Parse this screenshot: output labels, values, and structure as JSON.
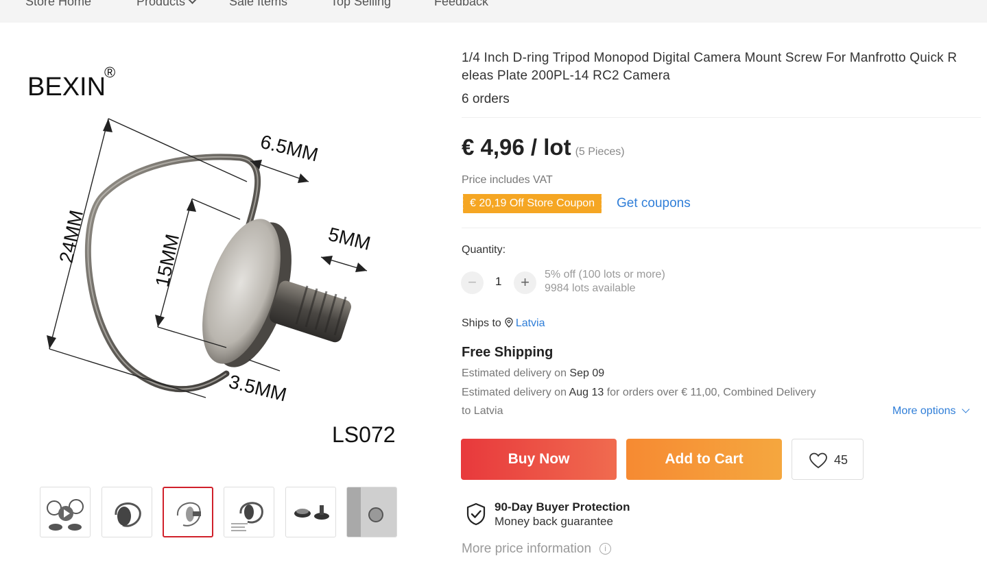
{
  "nav": {
    "items": [
      {
        "label": "Store Home"
      },
      {
        "label": "Products"
      },
      {
        "label": "Sale Items"
      },
      {
        "label": "Top Selling"
      },
      {
        "label": "Feedback"
      }
    ]
  },
  "gallery": {
    "brand": "BEXIN",
    "registered_mark": "®",
    "model": "LS072",
    "dimensions": {
      "total_height": "24MM",
      "plate_diameter": "15MM",
      "ring_width": "6.5MM",
      "screw_length": "5MM",
      "plate_thickness": "3.5MM"
    },
    "thumbnails_count": 6,
    "active_thumbnail": 3
  },
  "product": {
    "title": "1/4 Inch D-ring Tripod Monopod Digital Camera Mount Screw For Manfrotto Quick R eleas Plate 200PL-14 RC2 Camera",
    "orders": "6 orders",
    "price": "€ 4,96 / lot",
    "price_unit_note": "(5 Pieces)",
    "vat_note": "Price includes VAT",
    "coupon": "€ 20,19 Off Store Coupon",
    "get_coupons": "Get coupons"
  },
  "quantity": {
    "label": "Quantity:",
    "value": "1",
    "minus": "−",
    "plus": "+",
    "discount": "5% off (100 lots or more)",
    "available": "9984 lots available"
  },
  "shipping": {
    "ships_to_label": "Ships to",
    "country": "Latvia",
    "free_shipping": "Free Shipping",
    "est1_prefix": "Estimated delivery on",
    "est1_date": "Sep 09",
    "est2_prefix": "Estimated delivery on",
    "est2_date": "Aug 13",
    "est2_suffix": "for orders over € 11,00, Combined Delivery",
    "est2_line2": "to Latvia",
    "more_options": "More options"
  },
  "actions": {
    "buy_now": "Buy Now",
    "add_to_cart": "Add to Cart",
    "wishlist_count": "45"
  },
  "protection": {
    "title": "90-Day Buyer Protection",
    "subtitle": "Money back guarantee"
  },
  "more_price_info": "More price information",
  "colors": {
    "buy_now": "#e8393c",
    "add_to_cart": "#f68a32",
    "coupon": "#f5a623",
    "link": "#2f7ed8"
  }
}
